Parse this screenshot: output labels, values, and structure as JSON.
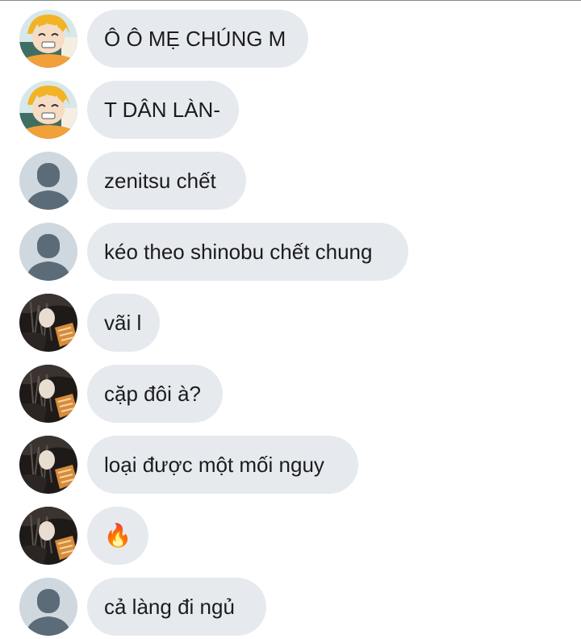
{
  "messages": [
    {
      "avatar": "zenitsu-avatar",
      "text": "Ô Ô MẸ CHÚNG M"
    },
    {
      "avatar": "zenitsu-avatar",
      "text": "T DÂN LÀN-"
    },
    {
      "avatar": "default-avatar",
      "text": "zenitsu chết"
    },
    {
      "avatar": "default-avatar",
      "text": "kéo theo shinobu chết chung"
    },
    {
      "avatar": "dark-hair-avatar",
      "text": "vãi l"
    },
    {
      "avatar": "dark-hair-avatar",
      "text": "cặp đôi à?"
    },
    {
      "avatar": "dark-hair-avatar",
      "text": "loại được một mối nguy"
    },
    {
      "avatar": "dark-hair-avatar",
      "text": "🔥"
    },
    {
      "avatar": "default-avatar",
      "text": "cả làng đi ngủ"
    }
  ]
}
